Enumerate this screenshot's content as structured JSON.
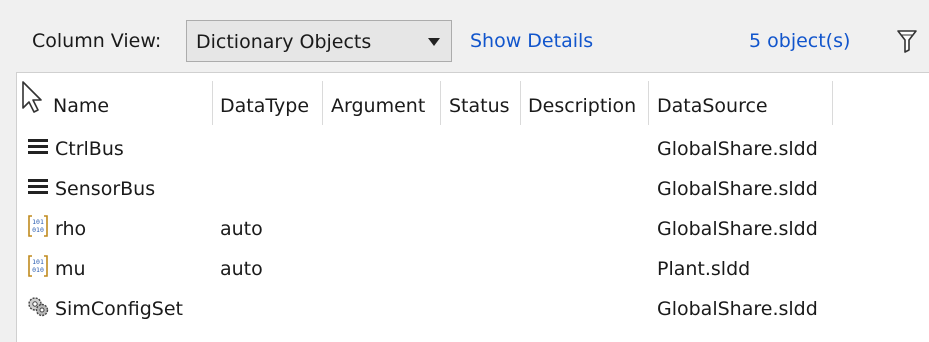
{
  "toolbar": {
    "column_view_label": "Column View:",
    "column_view_value": "Dictionary Objects",
    "show_details_label": "Show Details",
    "object_count": "5 object(s)"
  },
  "table": {
    "columns": [
      "Name",
      "DataType",
      "Argument",
      "Status",
      "Description",
      "DataSource"
    ],
    "rows": [
      {
        "icon": "bus-icon",
        "name": "CtrlBus",
        "datatype": "",
        "argument": "",
        "status": "",
        "description": "",
        "datasource": "GlobalShare.sldd"
      },
      {
        "icon": "bus-icon",
        "name": "SensorBus",
        "datatype": "",
        "argument": "",
        "status": "",
        "description": "",
        "datasource": "GlobalShare.sldd"
      },
      {
        "icon": "parameter-icon",
        "name": "rho",
        "datatype": "auto",
        "argument": "",
        "status": "",
        "description": "",
        "datasource": "GlobalShare.sldd"
      },
      {
        "icon": "parameter-icon",
        "name": "mu",
        "datatype": "auto",
        "argument": "",
        "status": "",
        "description": "",
        "datasource": "Plant.sldd"
      },
      {
        "icon": "config-set-icon",
        "name": "SimConfigSet",
        "datatype": "",
        "argument": "",
        "status": "",
        "description": "",
        "datasource": "GlobalShare.sldd"
      }
    ]
  },
  "colors": {
    "link": "#1155cc",
    "toolbar_bg": "#f0f0f0",
    "table_bg": "#ffffff"
  }
}
